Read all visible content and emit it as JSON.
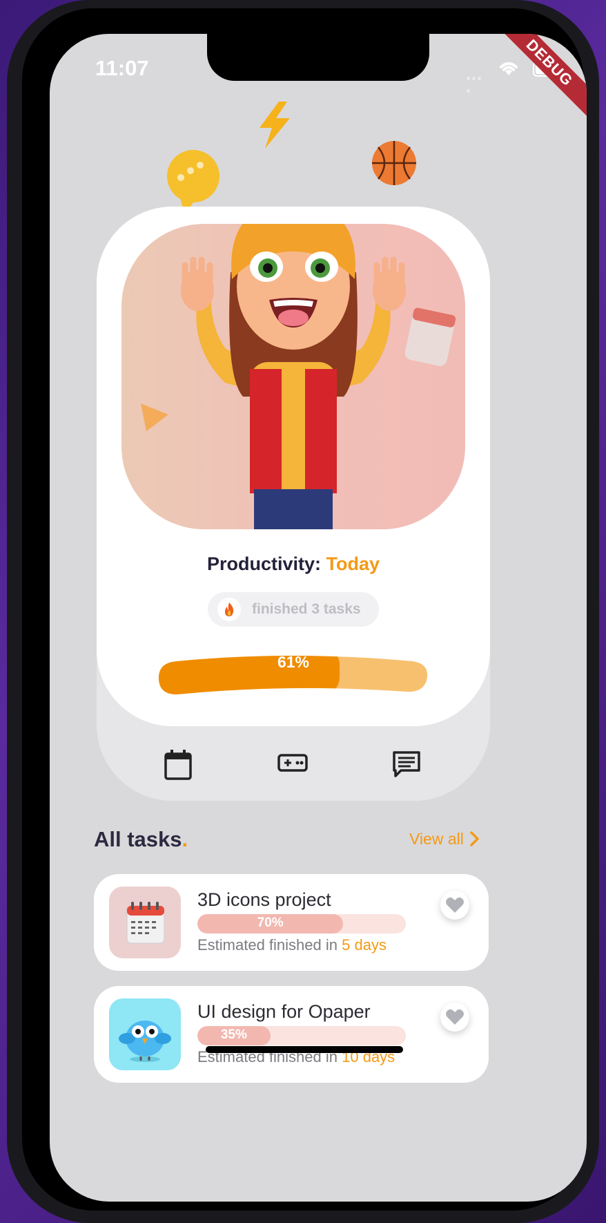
{
  "status_bar": {
    "time": "11:07",
    "debug_label": "DEBUG"
  },
  "hero": {
    "title_prefix": "Productivity:",
    "title_accent": "Today",
    "badge_text": "finished 3 tasks",
    "progress_percent": 61,
    "progress_label": "61%"
  },
  "nav": {
    "items": [
      "calendar-icon",
      "gamepad-icon",
      "chat-icon"
    ]
  },
  "tasks_section": {
    "title": "All tasks",
    "title_dot": ".",
    "view_all": "View all"
  },
  "tasks": [
    {
      "name": "3D icons project",
      "percent": 70,
      "percent_label": "70%",
      "est_prefix": "Estimated finished in",
      "est_value": "5 days",
      "thumb_icon": "calendar-3d-icon"
    },
    {
      "name": "UI design for Opaper",
      "percent": 35,
      "percent_label": "35%",
      "est_prefix": "Estimated finished in",
      "est_value": "10 days",
      "thumb_icon": "bird-3d-icon"
    }
  ],
  "colors": {
    "accent": "#f39a16",
    "dark_text": "#24223a",
    "progress_track": "#f7c06f"
  }
}
